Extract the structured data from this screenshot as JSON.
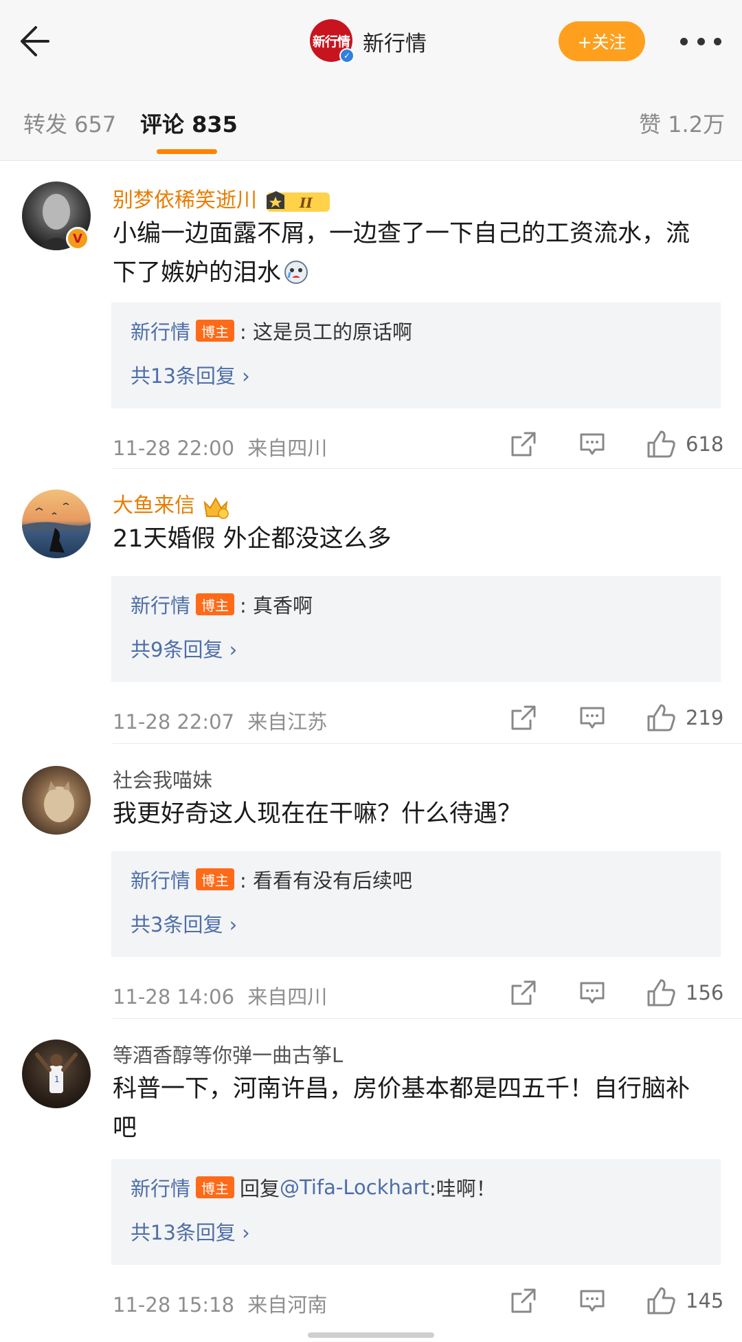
{
  "header": {
    "account_name": "新行情",
    "logo_text": "新行情",
    "follow_label": "+关注"
  },
  "tabs": {
    "repost": "转发 657",
    "comments": "评论 835",
    "likes": "赞 1.2万"
  },
  "comments": [
    {
      "username": "别梦依稀笑逝川",
      "text": "小编一边面露不屑，一边查了一下自己的工资流水，流下了嫉妒的泪水",
      "reply_author": "新行情",
      "reply_badge": "博主",
      "reply_text": ": 这是员工的原话啊",
      "reply_more": "共13条回复 ›",
      "time": "11-28 22:00",
      "location": "来自四川",
      "likes": "618"
    },
    {
      "username": "大鱼来信",
      "text": "21天婚假 外企都没这么多",
      "reply_author": "新行情",
      "reply_badge": "博主",
      "reply_text": ": 真香啊",
      "reply_more": "共9条回复 ›",
      "time": "11-28 22:07",
      "location": "来自江苏",
      "likes": "219"
    },
    {
      "username": "社会我喵妹",
      "text": "我更好奇这人现在在干嘛？什么待遇？",
      "reply_author": "新行情",
      "reply_badge": "博主",
      "reply_text": ": 看看有没有后续吧",
      "reply_more": "共3条回复 ›",
      "time": "11-28 14:06",
      "location": "来自四川",
      "likes": "156"
    },
    {
      "username": "等酒香醇等你弹一曲古筝L",
      "text": "科普一下，河南许昌，房价基本都是四五千！自行脑补吧",
      "reply_author": "新行情",
      "reply_badge": "博主",
      "reply_prefix": "回复",
      "reply_mention": "@Tifa-Lockhart",
      "reply_text": ":哇啊！",
      "reply_more": "共13条回复 ›",
      "time": "11-28 15:18",
      "location": "来自河南",
      "likes": "145"
    }
  ],
  "colors": {
    "accent_orange": "#ff8200",
    "follow_button": "#ff9f1e",
    "vip_name": "#e87d00",
    "link_blue": "#4d6ea8",
    "badge_orange": "#ff6a18"
  }
}
